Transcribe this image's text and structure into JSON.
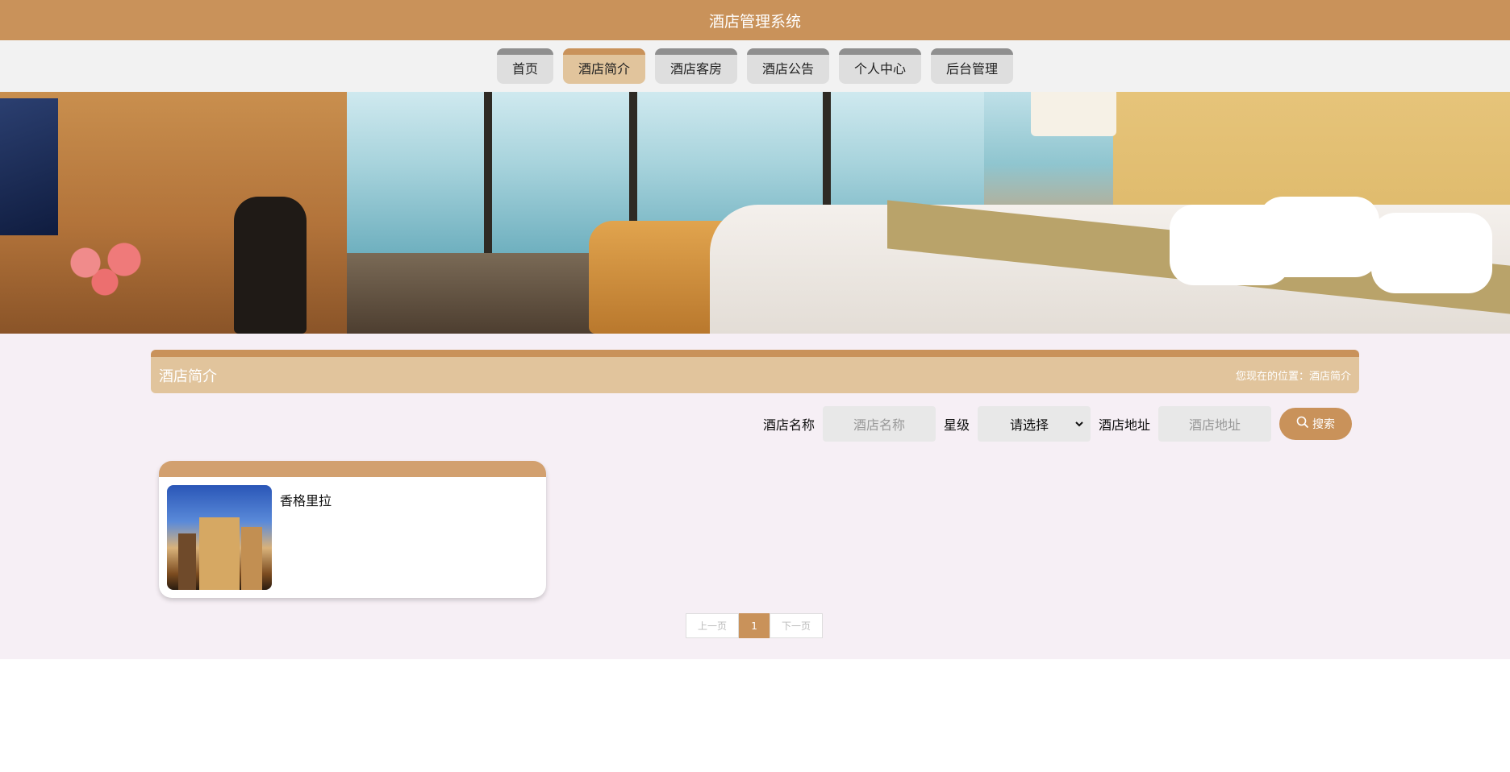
{
  "app": {
    "title": "酒店管理系统"
  },
  "nav": {
    "items": [
      {
        "label": "首页",
        "active": false
      },
      {
        "label": "酒店简介",
        "active": true
      },
      {
        "label": "酒店客房",
        "active": false
      },
      {
        "label": "酒店公告",
        "active": false
      },
      {
        "label": "个人中心",
        "active": false
      },
      {
        "label": "后台管理",
        "active": false
      }
    ]
  },
  "section": {
    "title": "酒店简介",
    "breadcrumb_prefix": "您现在的位置：",
    "breadcrumb_current": "酒店简介"
  },
  "search": {
    "name_label": "酒店名称",
    "name_placeholder": "酒店名称",
    "star_label": "星级",
    "star_selected": "请选择",
    "address_label": "酒店地址",
    "address_placeholder": "酒店地址",
    "button_label": "搜索",
    "button_icon": "search-icon"
  },
  "hotels": [
    {
      "name": "香格里拉"
    }
  ],
  "pagination": {
    "prev_label": "上一页",
    "current_page": "1",
    "next_label": "下一页"
  },
  "colors": {
    "brand": "#c9925a",
    "accent_light": "#e1c49c",
    "content_bg": "#f6eff5"
  }
}
